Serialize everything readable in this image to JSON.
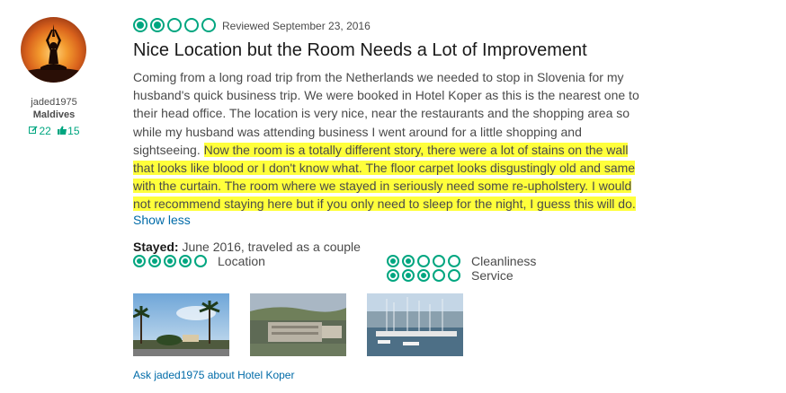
{
  "user": {
    "name": "jaded1975",
    "location": "Maldives",
    "reviews_count": "22",
    "helpful_votes": "15",
    "reviews_icon": "pencil-icon",
    "helpful_icon": "thumbs-up-icon"
  },
  "review": {
    "rating": 2,
    "max_rating": 5,
    "date": "Reviewed September 23, 2016",
    "title": "Nice Location but the Room Needs a Lot of Improvement",
    "text_plain": "Coming from a long road trip from the Netherlands we needed to stop in Slovenia for my husband's quick business trip. We were booked in Hotel Koper as this is the nearest one to their head office. The location is very nice, near the restaurants and the shopping area so while my husband was attending business I went around for a little shopping and sightseeing. ",
    "text_highlighted": "Now the room is a totally different story, there were a lot of stains on the wall that looks like blood or I don't know what. The floor carpet looks disgustingly old and same with the curtain. The room where we stayed in seriously need some re-upholstery. I would not recommend staying here but if you only need to sleep for the night, I guess this will do.",
    "show_less": "Show less",
    "stayed_label": "Stayed:",
    "stayed_value": " June 2016, traveled as a couple",
    "sub_ratings": [
      {
        "label": "Location",
        "rating": 4
      },
      {
        "label": "Cleanliness",
        "rating": 2
      },
      {
        "label": "Service",
        "rating": 3
      }
    ],
    "photos": [
      "photo-palm-trees",
      "photo-hotel-aerial",
      "photo-marina"
    ],
    "ask_link": "Ask jaded1975 about Hotel Koper"
  },
  "colors": {
    "brand_green": "#00a680",
    "link_blue": "#006ba8",
    "highlight_yellow": "#ffff3b"
  }
}
